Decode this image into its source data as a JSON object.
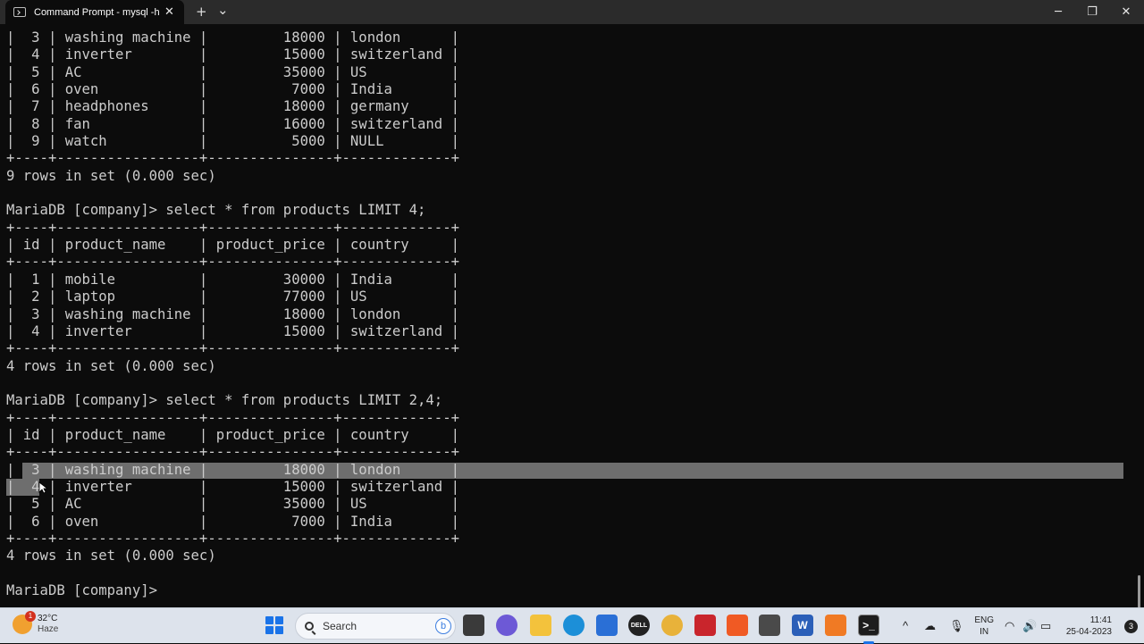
{
  "window": {
    "tab_title": "Command Prompt - mysql  -h",
    "tab_close": "✕",
    "new_tab": "+",
    "dropdown": "⌄",
    "minimize": "─",
    "maximize": "❐",
    "close": "✕"
  },
  "terminal": {
    "lines": [
      "|  3 | washing machine |         18000 | london      |",
      "|  4 | inverter        |         15000 | switzerland |",
      "|  5 | AC              |         35000 | US          |",
      "|  6 | oven            |          7000 | India       |",
      "|  7 | headphones      |         18000 | germany     |",
      "|  8 | fan             |         16000 | switzerland |",
      "|  9 | watch           |          5000 | NULL        |",
      "+----+-----------------+---------------+-------------+",
      "9 rows in set (0.000 sec)",
      "",
      "MariaDB [company]> select * from products LIMIT 4;",
      "+----+-----------------+---------------+-------------+",
      "| id | product_name    | product_price | country     |",
      "+----+-----------------+---------------+-------------+",
      "|  1 | mobile          |         30000 | India       |",
      "|  2 | laptop          |         77000 | US          |",
      "|  3 | washing machine |         18000 | london      |",
      "|  4 | inverter        |         15000 | switzerland |",
      "+----+-----------------+---------------+-------------+",
      "4 rows in set (0.000 sec)",
      "",
      "MariaDB [company]> select * from products LIMIT 2,4;",
      "+----+-----------------+---------------+-------------+",
      "| id | product_name    | product_price | country     |",
      "+----+-----------------+---------------+-------------+",
      "|  3 | washing machine |         18000 | london      |",
      "|  4 | inverter        |         15000 | switzerland |",
      "|  5 | AC              |         35000 | US          |",
      "|  6 | oven            |          7000 | India       |",
      "+----+-----------------+---------------+-------------+",
      "4 rows in set (0.000 sec)",
      "",
      "MariaDB [company]> "
    ],
    "selection_color": "#6e6e6e",
    "text_color": "#cccccc",
    "background": "#0c0c0c"
  },
  "taskbar": {
    "weather": {
      "badge": "1",
      "temp": "32°C",
      "condition": "Haze"
    },
    "search_placeholder": "Search",
    "bing_icon": "b",
    "apps": [
      "file-explorer-icon",
      "taskview-icon",
      "chat-icon",
      "folder-icon",
      "edge-icon",
      "store-icon",
      "dell-icon",
      "chrome-icon",
      "mcafee-icon",
      "brave-icon",
      "sublime-icon",
      "word-icon",
      "xampp-icon",
      "terminal-icon"
    ],
    "tray": {
      "chevron": "^",
      "lang_top": "ENG",
      "lang_bottom": "IN",
      "time": "11:41",
      "date": "25-04-2023",
      "notifications": "3"
    }
  }
}
